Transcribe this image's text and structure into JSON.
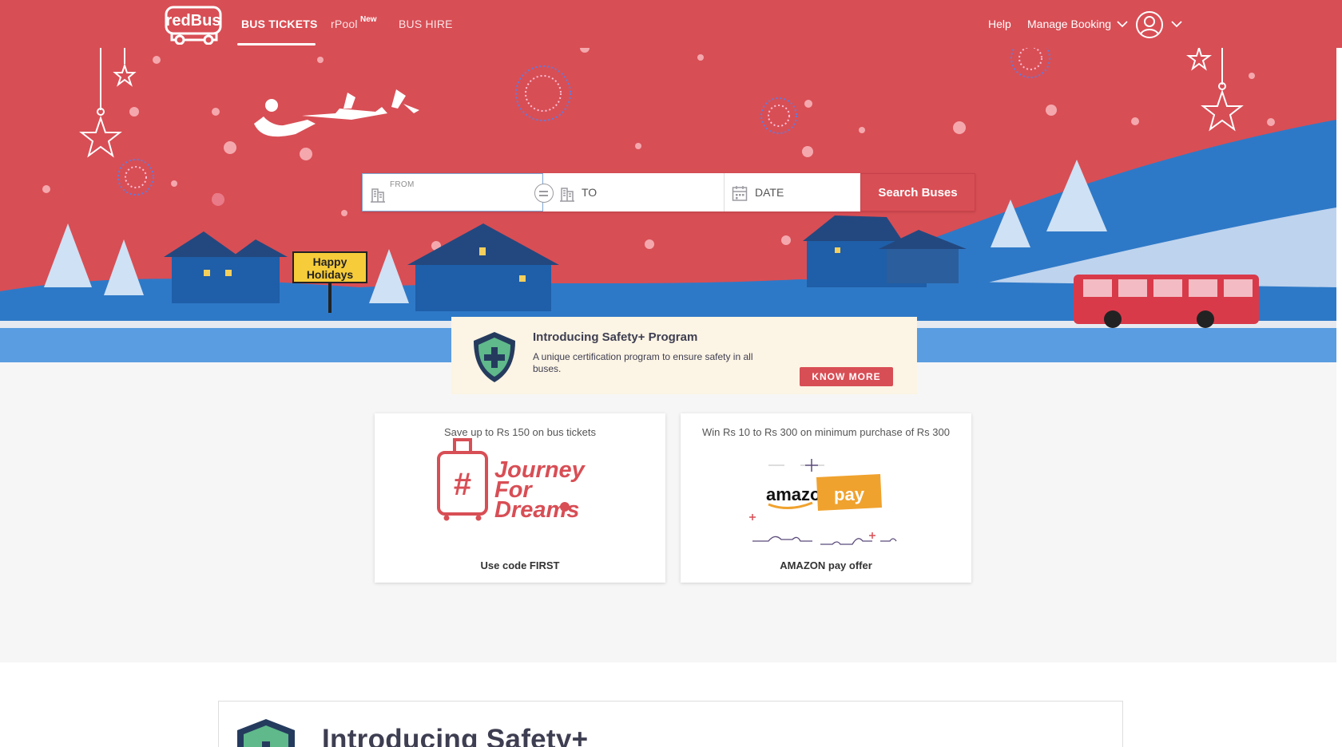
{
  "header": {
    "brand": "redBus",
    "nav": [
      {
        "label": "BUS TICKETS",
        "active": true
      },
      {
        "label": "rPool",
        "badge": "New"
      },
      {
        "label": "BUS HIRE"
      }
    ],
    "help": "Help",
    "manage_booking": "Manage Booking"
  },
  "hero": {
    "sign_line1": "Happy",
    "sign_line2": "Holidays"
  },
  "search": {
    "from_label": "FROM",
    "to_label": "TO",
    "date_label": "DATE",
    "button": "Search Buses"
  },
  "safety_banner": {
    "title": "Introducing Safety+ Program",
    "description": "A unique certification program to ensure safety in all buses.",
    "button": "KNOW MORE"
  },
  "offers": [
    {
      "title": "Save up to Rs 150 on bus tickets",
      "footer": "Use code FIRST",
      "art_text": [
        "Journey",
        "For",
        "Dreams"
      ],
      "art_symbol": "#"
    },
    {
      "title": "Win Rs 10 to Rs 300 on minimum purchase of Rs 300",
      "footer": "AMAZON pay offer",
      "art_text": [
        "amazon",
        "pay"
      ]
    }
  ],
  "safety_section": {
    "title": "Introducing Safety+"
  },
  "colors": {
    "brand_red": "#d84e55",
    "banner_bg": "#fcf4e4",
    "snow_blue": "#2e79c7",
    "shield_green": "#5fb98a",
    "shield_navy": "#253b5e"
  }
}
